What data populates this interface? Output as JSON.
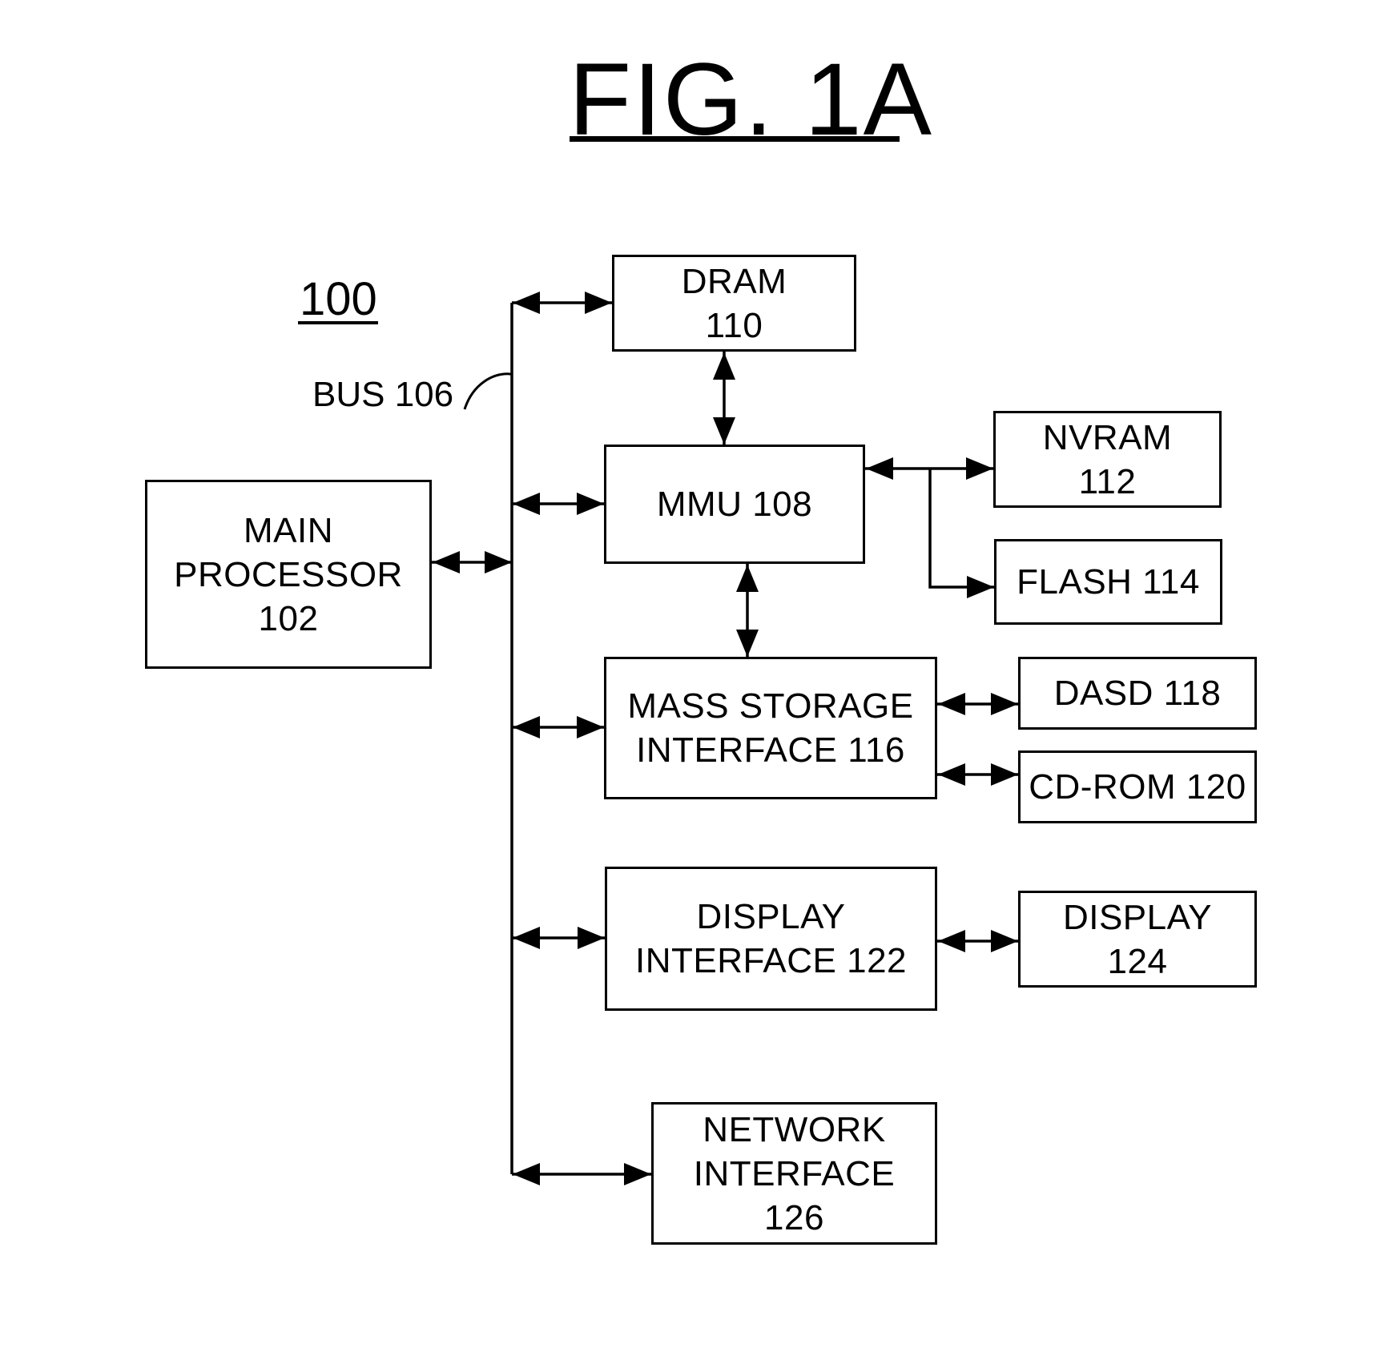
{
  "figure": {
    "title": "FIG. 1A",
    "reference_number": "100",
    "bus_label": "BUS 106"
  },
  "blocks": {
    "main_processor": [
      "MAIN",
      "PROCESSOR",
      "102"
    ],
    "dram": [
      "DRAM",
      "110"
    ],
    "mmu": [
      "MMU 108"
    ],
    "nvram": [
      "NVRAM",
      "112"
    ],
    "flash": [
      "FLASH 114"
    ],
    "mass_storage": [
      "MASS STORAGE",
      "INTERFACE 116"
    ],
    "dasd": [
      "DASD 118"
    ],
    "cdrom": [
      "CD-ROM 120"
    ],
    "display_interface": [
      "DISPLAY",
      "INTERFACE 122"
    ],
    "display": [
      "DISPLAY",
      "124"
    ],
    "network_interface": [
      "NETWORK",
      "INTERFACE",
      "126"
    ]
  },
  "connections": [
    {
      "from": "main_processor",
      "to": "bus_106",
      "type": "bidirectional"
    },
    {
      "from": "bus_106",
      "to": "dram",
      "type": "bidirectional"
    },
    {
      "from": "bus_106",
      "to": "mmu",
      "type": "bidirectional"
    },
    {
      "from": "bus_106",
      "to": "mass_storage",
      "type": "bidirectional"
    },
    {
      "from": "bus_106",
      "to": "display_interface",
      "type": "bidirectional"
    },
    {
      "from": "bus_106",
      "to": "network_interface",
      "type": "bidirectional"
    },
    {
      "from": "dram",
      "to": "mmu",
      "type": "bidirectional"
    },
    {
      "from": "mmu",
      "to": "nvram",
      "type": "bidirectional"
    },
    {
      "from": "mmu",
      "to": "flash",
      "type": "unidirectional"
    },
    {
      "from": "mmu",
      "to": "mass_storage",
      "type": "bidirectional"
    },
    {
      "from": "mass_storage",
      "to": "dasd",
      "type": "bidirectional"
    },
    {
      "from": "mass_storage",
      "to": "cdrom",
      "type": "bidirectional"
    },
    {
      "from": "display_interface",
      "to": "display",
      "type": "bidirectional"
    }
  ]
}
